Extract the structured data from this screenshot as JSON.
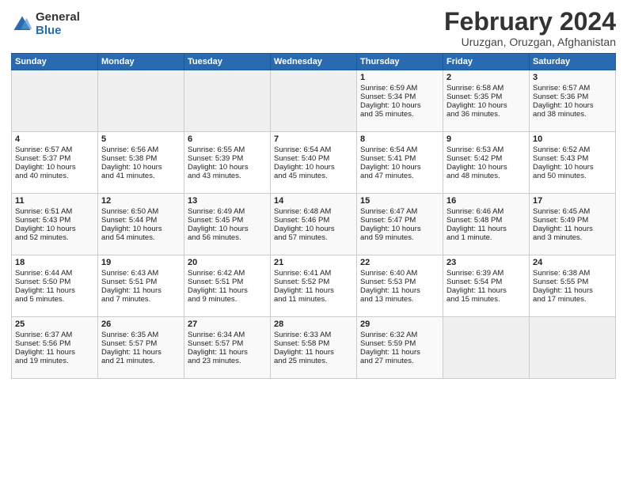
{
  "header": {
    "logo_general": "General",
    "logo_blue": "Blue",
    "title": "February 2024",
    "location": "Uruzgan, Oruzgan, Afghanistan"
  },
  "weekdays": [
    "Sunday",
    "Monday",
    "Tuesday",
    "Wednesday",
    "Thursday",
    "Friday",
    "Saturday"
  ],
  "weeks": [
    [
      {
        "day": "",
        "lines": []
      },
      {
        "day": "",
        "lines": []
      },
      {
        "day": "",
        "lines": []
      },
      {
        "day": "",
        "lines": []
      },
      {
        "day": "1",
        "lines": [
          "Sunrise: 6:59 AM",
          "Sunset: 5:34 PM",
          "Daylight: 10 hours",
          "and 35 minutes."
        ]
      },
      {
        "day": "2",
        "lines": [
          "Sunrise: 6:58 AM",
          "Sunset: 5:35 PM",
          "Daylight: 10 hours",
          "and 36 minutes."
        ]
      },
      {
        "day": "3",
        "lines": [
          "Sunrise: 6:57 AM",
          "Sunset: 5:36 PM",
          "Daylight: 10 hours",
          "and 38 minutes."
        ]
      }
    ],
    [
      {
        "day": "4",
        "lines": [
          "Sunrise: 6:57 AM",
          "Sunset: 5:37 PM",
          "Daylight: 10 hours",
          "and 40 minutes."
        ]
      },
      {
        "day": "5",
        "lines": [
          "Sunrise: 6:56 AM",
          "Sunset: 5:38 PM",
          "Daylight: 10 hours",
          "and 41 minutes."
        ]
      },
      {
        "day": "6",
        "lines": [
          "Sunrise: 6:55 AM",
          "Sunset: 5:39 PM",
          "Daylight: 10 hours",
          "and 43 minutes."
        ]
      },
      {
        "day": "7",
        "lines": [
          "Sunrise: 6:54 AM",
          "Sunset: 5:40 PM",
          "Daylight: 10 hours",
          "and 45 minutes."
        ]
      },
      {
        "day": "8",
        "lines": [
          "Sunrise: 6:54 AM",
          "Sunset: 5:41 PM",
          "Daylight: 10 hours",
          "and 47 minutes."
        ]
      },
      {
        "day": "9",
        "lines": [
          "Sunrise: 6:53 AM",
          "Sunset: 5:42 PM",
          "Daylight: 10 hours",
          "and 48 minutes."
        ]
      },
      {
        "day": "10",
        "lines": [
          "Sunrise: 6:52 AM",
          "Sunset: 5:43 PM",
          "Daylight: 10 hours",
          "and 50 minutes."
        ]
      }
    ],
    [
      {
        "day": "11",
        "lines": [
          "Sunrise: 6:51 AM",
          "Sunset: 5:43 PM",
          "Daylight: 10 hours",
          "and 52 minutes."
        ]
      },
      {
        "day": "12",
        "lines": [
          "Sunrise: 6:50 AM",
          "Sunset: 5:44 PM",
          "Daylight: 10 hours",
          "and 54 minutes."
        ]
      },
      {
        "day": "13",
        "lines": [
          "Sunrise: 6:49 AM",
          "Sunset: 5:45 PM",
          "Daylight: 10 hours",
          "and 56 minutes."
        ]
      },
      {
        "day": "14",
        "lines": [
          "Sunrise: 6:48 AM",
          "Sunset: 5:46 PM",
          "Daylight: 10 hours",
          "and 57 minutes."
        ]
      },
      {
        "day": "15",
        "lines": [
          "Sunrise: 6:47 AM",
          "Sunset: 5:47 PM",
          "Daylight: 10 hours",
          "and 59 minutes."
        ]
      },
      {
        "day": "16",
        "lines": [
          "Sunrise: 6:46 AM",
          "Sunset: 5:48 PM",
          "Daylight: 11 hours",
          "and 1 minute."
        ]
      },
      {
        "day": "17",
        "lines": [
          "Sunrise: 6:45 AM",
          "Sunset: 5:49 PM",
          "Daylight: 11 hours",
          "and 3 minutes."
        ]
      }
    ],
    [
      {
        "day": "18",
        "lines": [
          "Sunrise: 6:44 AM",
          "Sunset: 5:50 PM",
          "Daylight: 11 hours",
          "and 5 minutes."
        ]
      },
      {
        "day": "19",
        "lines": [
          "Sunrise: 6:43 AM",
          "Sunset: 5:51 PM",
          "Daylight: 11 hours",
          "and 7 minutes."
        ]
      },
      {
        "day": "20",
        "lines": [
          "Sunrise: 6:42 AM",
          "Sunset: 5:51 PM",
          "Daylight: 11 hours",
          "and 9 minutes."
        ]
      },
      {
        "day": "21",
        "lines": [
          "Sunrise: 6:41 AM",
          "Sunset: 5:52 PM",
          "Daylight: 11 hours",
          "and 11 minutes."
        ]
      },
      {
        "day": "22",
        "lines": [
          "Sunrise: 6:40 AM",
          "Sunset: 5:53 PM",
          "Daylight: 11 hours",
          "and 13 minutes."
        ]
      },
      {
        "day": "23",
        "lines": [
          "Sunrise: 6:39 AM",
          "Sunset: 5:54 PM",
          "Daylight: 11 hours",
          "and 15 minutes."
        ]
      },
      {
        "day": "24",
        "lines": [
          "Sunrise: 6:38 AM",
          "Sunset: 5:55 PM",
          "Daylight: 11 hours",
          "and 17 minutes."
        ]
      }
    ],
    [
      {
        "day": "25",
        "lines": [
          "Sunrise: 6:37 AM",
          "Sunset: 5:56 PM",
          "Daylight: 11 hours",
          "and 19 minutes."
        ]
      },
      {
        "day": "26",
        "lines": [
          "Sunrise: 6:35 AM",
          "Sunset: 5:57 PM",
          "Daylight: 11 hours",
          "and 21 minutes."
        ]
      },
      {
        "day": "27",
        "lines": [
          "Sunrise: 6:34 AM",
          "Sunset: 5:57 PM",
          "Daylight: 11 hours",
          "and 23 minutes."
        ]
      },
      {
        "day": "28",
        "lines": [
          "Sunrise: 6:33 AM",
          "Sunset: 5:58 PM",
          "Daylight: 11 hours",
          "and 25 minutes."
        ]
      },
      {
        "day": "29",
        "lines": [
          "Sunrise: 6:32 AM",
          "Sunset: 5:59 PM",
          "Daylight: 11 hours",
          "and 27 minutes."
        ]
      },
      {
        "day": "",
        "lines": []
      },
      {
        "day": "",
        "lines": []
      }
    ]
  ]
}
